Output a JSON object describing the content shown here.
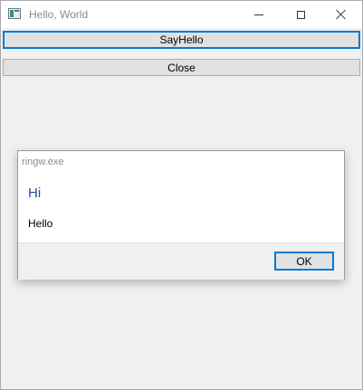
{
  "window": {
    "title": "Hello, World",
    "icon": "app-window-icon",
    "controls": {
      "minimize": "minimize-icon",
      "maximize": "maximize-icon",
      "close": "close-icon"
    }
  },
  "buttons": {
    "sayhello_label": "SayHello",
    "close_label": "Close"
  },
  "dialog": {
    "title": "ringw.exe",
    "heading": "Hi",
    "message": "Hello",
    "ok_label": "OK"
  },
  "colors": {
    "accent": "#0078d7",
    "heading": "#1f4e99",
    "window_bg": "#f0f0f0",
    "button_bg": "#e1e1e1"
  }
}
